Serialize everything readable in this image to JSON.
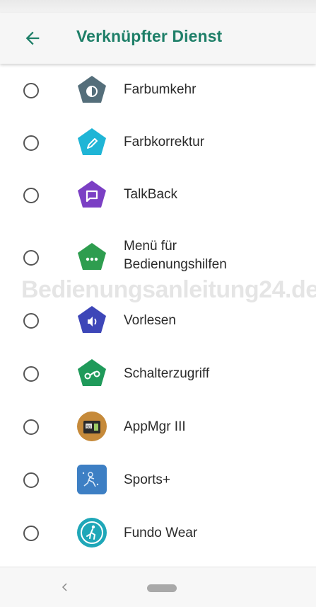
{
  "header": {
    "title": "Verknüpfter Dienst",
    "back_icon": "arrow-left-icon",
    "accent_color": "#1e7f68"
  },
  "services": [
    {
      "label": "Farbumkehr",
      "icon": "color-inversion-icon",
      "color": "#546e7a",
      "selected": false
    },
    {
      "label": "Farbkorrektur",
      "icon": "color-correction-icon",
      "color": "#1fb5d6",
      "selected": false
    },
    {
      "label": "TalkBack",
      "icon": "talkback-icon",
      "color": "#7b3fc4",
      "selected": false
    },
    {
      "label": "Menü für\nBedienungshilfen",
      "icon": "accessibility-menu-icon",
      "color": "#2e9d4f",
      "selected": false
    },
    {
      "label": "Vorlesen",
      "icon": "select-to-speak-icon",
      "color": "#3d46b8",
      "selected": false
    },
    {
      "label": "Schalterzugriff",
      "icon": "switch-access-icon",
      "color": "#1f9a5a",
      "selected": false
    },
    {
      "label": "AppMgr III",
      "icon": "appmgr-icon",
      "color": "#c68a3a",
      "selected": false
    },
    {
      "label": "Sports+",
      "icon": "sports-plus-icon",
      "color": "#3d7fc4",
      "selected": false
    },
    {
      "label": "Fundo Wear",
      "icon": "fundo-wear-icon",
      "color": "#1fa7b8",
      "selected": false
    }
  ],
  "watermark": "Bedienungsanleitung24.de",
  "navbar": {
    "back_icon": "nav-back-icon",
    "home_icon": "nav-home-pill-icon"
  }
}
